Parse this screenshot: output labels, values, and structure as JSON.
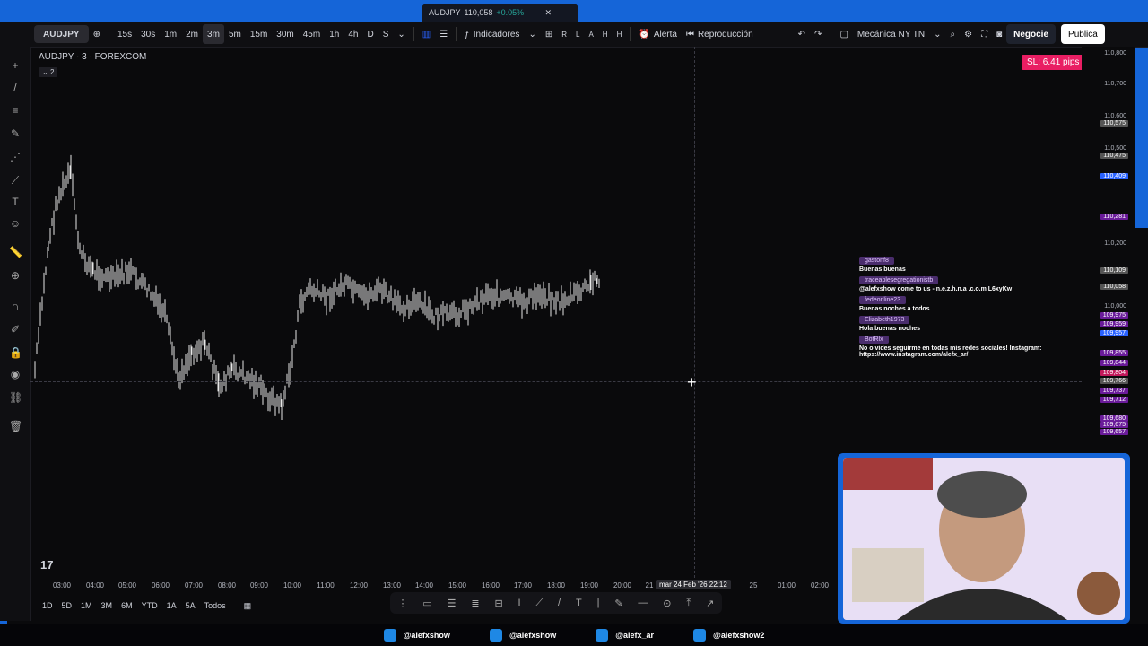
{
  "tab": {
    "symbol": "AUDJPY",
    "price": "110,058",
    "change": "+0.05%"
  },
  "toolbar": {
    "symbol": "AUDJPY",
    "timeframes": [
      "15s",
      "30s",
      "1m",
      "2m",
      "3m",
      "5m",
      "15m",
      "30m",
      "45m",
      "1h",
      "4h",
      "D",
      "S"
    ],
    "active_timeframe": "3m",
    "indicators": "Indicadores",
    "alert": "Alerta",
    "replay": "Reproducción",
    "layout": "Mecánica NY TN",
    "trade": "Negocie",
    "publish": "Publica",
    "rlahn": [
      "R",
      "L",
      "A",
      "H",
      "H"
    ]
  },
  "legend": {
    "title": "AUDJPY · 3 · FOREXCOM",
    "count": "2"
  },
  "sl_badge": "SL: 6.41 pips",
  "yaxis": {
    "labels": [
      "110,800",
      "110,700",
      "110,600",
      "110,500",
      "110,200",
      "110,000"
    ],
    "badges": [
      {
        "text": "110,575",
        "color": "#555"
      },
      {
        "text": "110,475",
        "color": "#555"
      },
      {
        "text": "110,409",
        "color": "#2962ff"
      },
      {
        "text": "110,281",
        "color": "#6a1b9a"
      },
      {
        "text": "110,109",
        "color": "#555"
      },
      {
        "text": "110,058",
        "color": "#555"
      },
      {
        "text": "109,975",
        "color": "#6a1b9a"
      },
      {
        "text": "109,959",
        "color": "#6a1b9a"
      },
      {
        "text": "109,957",
        "color": "#2962ff"
      },
      {
        "text": "109,855",
        "color": "#6a1b9a"
      },
      {
        "text": "109,844",
        "color": "#6a1b9a"
      },
      {
        "text": "109,804",
        "color": "#c2185b"
      },
      {
        "text": "109,766",
        "color": "#555"
      },
      {
        "text": "109,737",
        "color": "#6a1b9a"
      },
      {
        "text": "109,712",
        "color": "#6a1b9a"
      },
      {
        "text": "109,680",
        "color": "#6a1b9a"
      },
      {
        "text": "109,675",
        "color": "#6a1b9a"
      },
      {
        "text": "109,657",
        "color": "#6a1b9a"
      }
    ]
  },
  "xaxis": {
    "labels": [
      "03:00",
      "04:00",
      "05:00",
      "06:00",
      "07:00",
      "08:00",
      "09:00",
      "10:00",
      "11:00",
      "12:00",
      "13:00",
      "14:00",
      "15:00",
      "16:00",
      "17:00",
      "18:00",
      "19:00",
      "20:00",
      "21",
      "25",
      "01:00",
      "02:00"
    ],
    "crosshair": "mar 24 Feb '26   22:12"
  },
  "ranges": [
    "1D",
    "5D",
    "1M",
    "3M",
    "6M",
    "YTD",
    "1A",
    "5A",
    "Todos"
  ],
  "chat": [
    {
      "user": "gastonf8",
      "text": "Buenas buenas"
    },
    {
      "user": "traceablesegregationistb",
      "text": "@alefxshow come to us - n.e.z.h.n.a .c.o.m L6xyKw"
    },
    {
      "user": "fedeonline23",
      "text": "Buenas noches a todos"
    },
    {
      "user": "Elizabeth1973",
      "text": "Hola buenas noches"
    },
    {
      "user": "BotRlx",
      "text": "No olvides seguirme en todas mis redes sociales! Instagram: https://www.instagram.com/alefx_ar/"
    }
  ],
  "footer": [
    {
      "icon": "tiktok-icon",
      "handle": "@alefxshow",
      "color": "#1e88e5"
    },
    {
      "icon": "x-icon",
      "handle": "@alefxshow",
      "color": "#1e88e5"
    },
    {
      "icon": "instagram-icon",
      "handle": "@alefx_ar",
      "color": "#1e88e5"
    },
    {
      "icon": "youtube-icon",
      "handle": "@alefxshow2",
      "color": "#1e88e5"
    }
  ]
}
